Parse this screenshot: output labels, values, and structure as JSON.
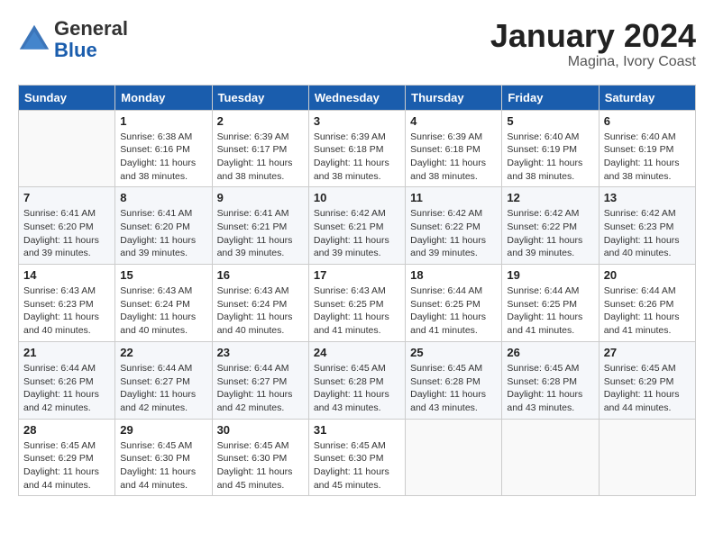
{
  "logo": {
    "general": "General",
    "blue": "Blue"
  },
  "title": "January 2024",
  "location": "Magina, Ivory Coast",
  "days_of_week": [
    "Sunday",
    "Monday",
    "Tuesday",
    "Wednesday",
    "Thursday",
    "Friday",
    "Saturday"
  ],
  "weeks": [
    [
      {
        "day": "",
        "info": ""
      },
      {
        "day": "1",
        "info": "Sunrise: 6:38 AM\nSunset: 6:16 PM\nDaylight: 11 hours and 38 minutes."
      },
      {
        "day": "2",
        "info": "Sunrise: 6:39 AM\nSunset: 6:17 PM\nDaylight: 11 hours and 38 minutes."
      },
      {
        "day": "3",
        "info": "Sunrise: 6:39 AM\nSunset: 6:18 PM\nDaylight: 11 hours and 38 minutes."
      },
      {
        "day": "4",
        "info": "Sunrise: 6:39 AM\nSunset: 6:18 PM\nDaylight: 11 hours and 38 minutes."
      },
      {
        "day": "5",
        "info": "Sunrise: 6:40 AM\nSunset: 6:19 PM\nDaylight: 11 hours and 38 minutes."
      },
      {
        "day": "6",
        "info": "Sunrise: 6:40 AM\nSunset: 6:19 PM\nDaylight: 11 hours and 38 minutes."
      }
    ],
    [
      {
        "day": "7",
        "info": "Sunrise: 6:41 AM\nSunset: 6:20 PM\nDaylight: 11 hours and 39 minutes."
      },
      {
        "day": "8",
        "info": "Sunrise: 6:41 AM\nSunset: 6:20 PM\nDaylight: 11 hours and 39 minutes."
      },
      {
        "day": "9",
        "info": "Sunrise: 6:41 AM\nSunset: 6:21 PM\nDaylight: 11 hours and 39 minutes."
      },
      {
        "day": "10",
        "info": "Sunrise: 6:42 AM\nSunset: 6:21 PM\nDaylight: 11 hours and 39 minutes."
      },
      {
        "day": "11",
        "info": "Sunrise: 6:42 AM\nSunset: 6:22 PM\nDaylight: 11 hours and 39 minutes."
      },
      {
        "day": "12",
        "info": "Sunrise: 6:42 AM\nSunset: 6:22 PM\nDaylight: 11 hours and 39 minutes."
      },
      {
        "day": "13",
        "info": "Sunrise: 6:42 AM\nSunset: 6:23 PM\nDaylight: 11 hours and 40 minutes."
      }
    ],
    [
      {
        "day": "14",
        "info": "Sunrise: 6:43 AM\nSunset: 6:23 PM\nDaylight: 11 hours and 40 minutes."
      },
      {
        "day": "15",
        "info": "Sunrise: 6:43 AM\nSunset: 6:24 PM\nDaylight: 11 hours and 40 minutes."
      },
      {
        "day": "16",
        "info": "Sunrise: 6:43 AM\nSunset: 6:24 PM\nDaylight: 11 hours and 40 minutes."
      },
      {
        "day": "17",
        "info": "Sunrise: 6:43 AM\nSunset: 6:25 PM\nDaylight: 11 hours and 41 minutes."
      },
      {
        "day": "18",
        "info": "Sunrise: 6:44 AM\nSunset: 6:25 PM\nDaylight: 11 hours and 41 minutes."
      },
      {
        "day": "19",
        "info": "Sunrise: 6:44 AM\nSunset: 6:25 PM\nDaylight: 11 hours and 41 minutes."
      },
      {
        "day": "20",
        "info": "Sunrise: 6:44 AM\nSunset: 6:26 PM\nDaylight: 11 hours and 41 minutes."
      }
    ],
    [
      {
        "day": "21",
        "info": "Sunrise: 6:44 AM\nSunset: 6:26 PM\nDaylight: 11 hours and 42 minutes."
      },
      {
        "day": "22",
        "info": "Sunrise: 6:44 AM\nSunset: 6:27 PM\nDaylight: 11 hours and 42 minutes."
      },
      {
        "day": "23",
        "info": "Sunrise: 6:44 AM\nSunset: 6:27 PM\nDaylight: 11 hours and 42 minutes."
      },
      {
        "day": "24",
        "info": "Sunrise: 6:45 AM\nSunset: 6:28 PM\nDaylight: 11 hours and 43 minutes."
      },
      {
        "day": "25",
        "info": "Sunrise: 6:45 AM\nSunset: 6:28 PM\nDaylight: 11 hours and 43 minutes."
      },
      {
        "day": "26",
        "info": "Sunrise: 6:45 AM\nSunset: 6:28 PM\nDaylight: 11 hours and 43 minutes."
      },
      {
        "day": "27",
        "info": "Sunrise: 6:45 AM\nSunset: 6:29 PM\nDaylight: 11 hours and 44 minutes."
      }
    ],
    [
      {
        "day": "28",
        "info": "Sunrise: 6:45 AM\nSunset: 6:29 PM\nDaylight: 11 hours and 44 minutes."
      },
      {
        "day": "29",
        "info": "Sunrise: 6:45 AM\nSunset: 6:30 PM\nDaylight: 11 hours and 44 minutes."
      },
      {
        "day": "30",
        "info": "Sunrise: 6:45 AM\nSunset: 6:30 PM\nDaylight: 11 hours and 45 minutes."
      },
      {
        "day": "31",
        "info": "Sunrise: 6:45 AM\nSunset: 6:30 PM\nDaylight: 11 hours and 45 minutes."
      },
      {
        "day": "",
        "info": ""
      },
      {
        "day": "",
        "info": ""
      },
      {
        "day": "",
        "info": ""
      }
    ]
  ]
}
